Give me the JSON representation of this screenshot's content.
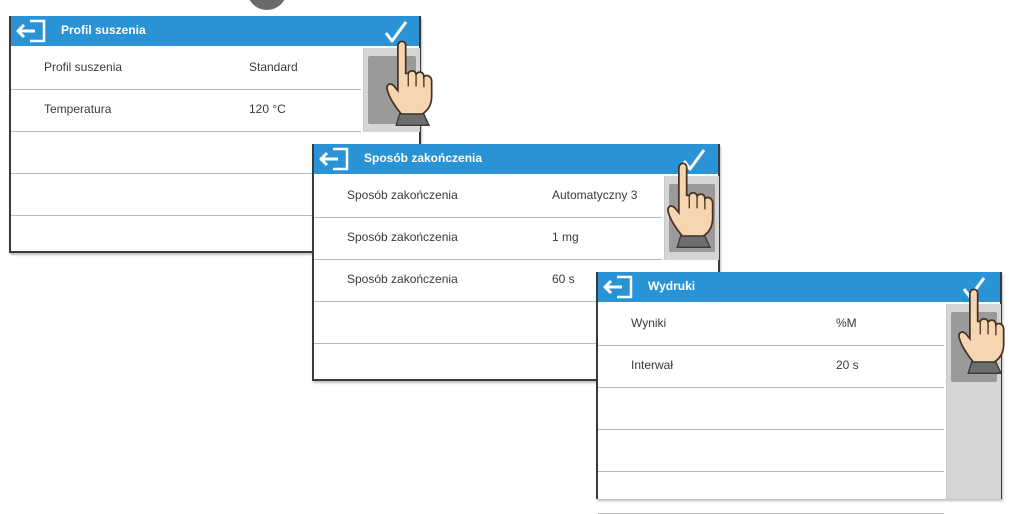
{
  "panel1": {
    "title": "Profil suszenia",
    "rows": [
      {
        "label": "Profil suszenia",
        "value": "Standard"
      },
      {
        "label": "Temperatura",
        "value": "120 °C"
      },
      {
        "label": "",
        "value": ""
      },
      {
        "label": "",
        "value": ""
      }
    ]
  },
  "panel2": {
    "title": "Sposób zakończenia",
    "rows": [
      {
        "label": "Sposób zakończenia",
        "value": "Automatyczny 3"
      },
      {
        "label": "Sposób zakończenia",
        "value": "1 mg"
      },
      {
        "label": "Sposób zakończenia",
        "value": "60 s"
      },
      {
        "label": "",
        "value": ""
      }
    ]
  },
  "panel3": {
    "title": "Wydruki",
    "rows": [
      {
        "label": "Wyniki",
        "value": "%M"
      },
      {
        "label": "Interwał",
        "value": "20 s"
      },
      {
        "label": "",
        "value": ""
      },
      {
        "label": "",
        "value": ""
      },
      {
        "label": "",
        "value": ""
      }
    ]
  },
  "colors": {
    "titlebar": "#2a93d5",
    "hand_outline": "#4a3020",
    "hand_skin": "#f5d6b0"
  }
}
